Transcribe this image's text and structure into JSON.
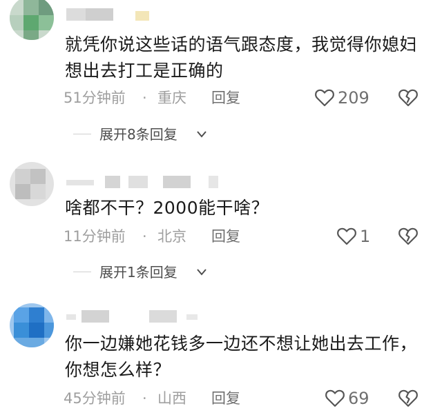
{
  "comments": [
    {
      "text": "就凭你说这些话的语气跟态度，我觉得你媳妇想出去打工是正确的",
      "time": "51分钟前",
      "dot": "·",
      "location": "重庆",
      "reply_label": "回复",
      "likes": "209",
      "expand_label": "展开8条回复"
    },
    {
      "text": "啥都不干？2000能干啥？",
      "time": "11分钟前",
      "dot": "·",
      "location": "北京",
      "reply_label": "回复",
      "likes": "1",
      "expand_label": "展开1条回复"
    },
    {
      "text": "你一边嫌她花钱多一边还不想让她出去工作，你想怎么样？",
      "time": "45分钟前",
      "dot": "·",
      "location": "山西",
      "reply_label": "回复",
      "likes": "69"
    }
  ],
  "icons": {
    "like": "heart-outline-icon",
    "dislike": "broken-heart-icon",
    "expand": "chevron-down-icon"
  },
  "colors": {
    "text": "#1a1a1a",
    "meta": "#9e9e9e",
    "action": "#6f6f6f",
    "avatar_1": "#6aa97a",
    "avatar_3": "#3a8fd8"
  }
}
